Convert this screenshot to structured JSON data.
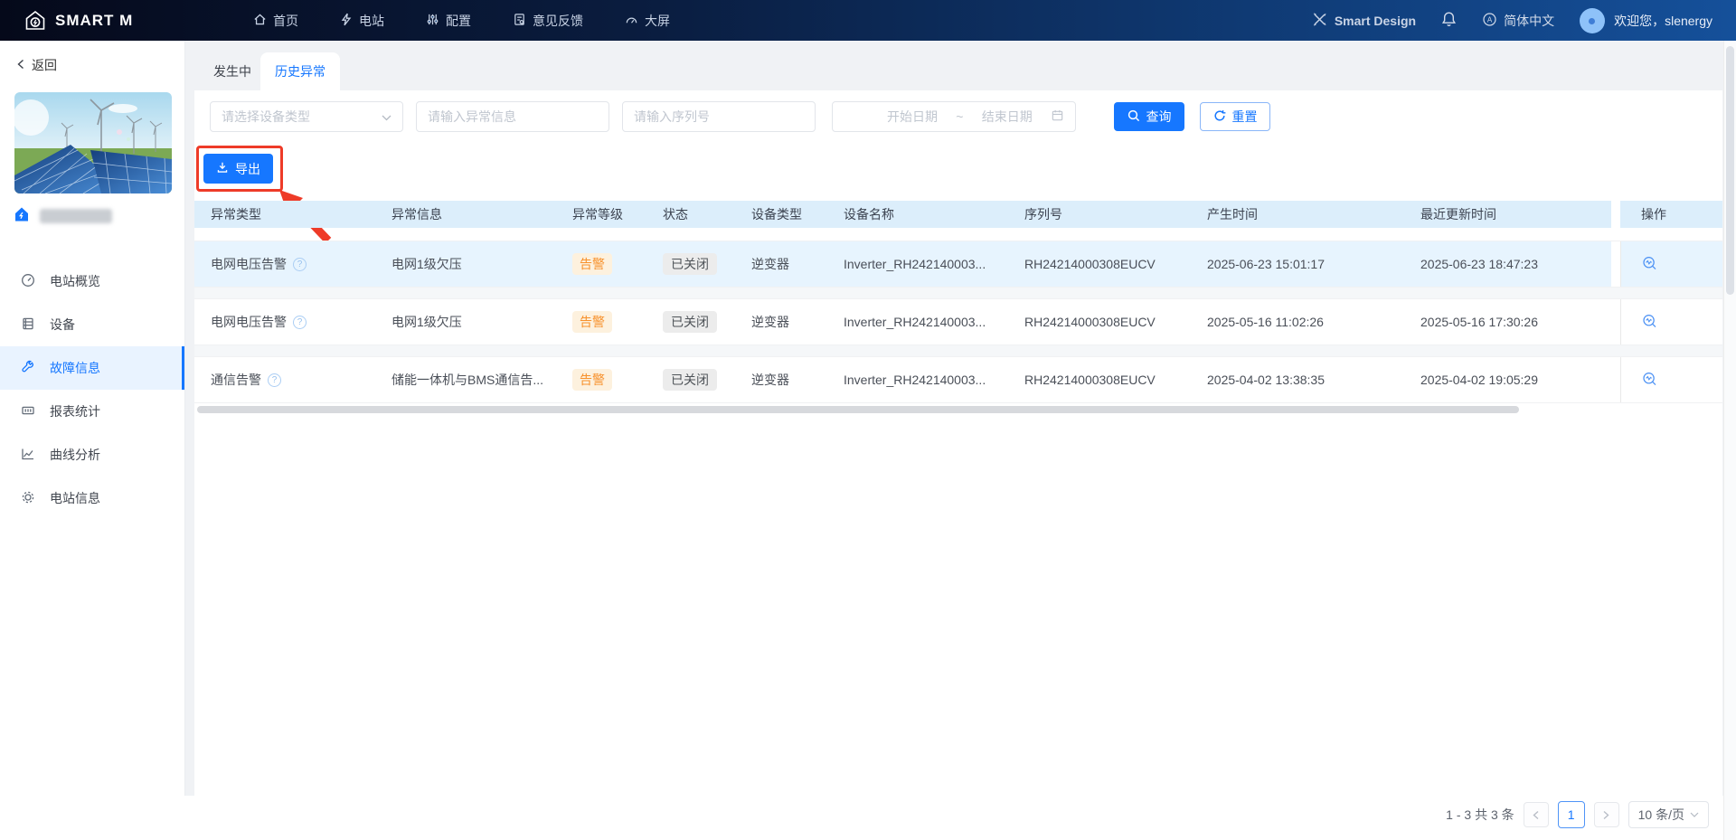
{
  "navbar": {
    "brand": "SMART M",
    "items": [
      {
        "label": "首页"
      },
      {
        "label": "电站"
      },
      {
        "label": "配置"
      },
      {
        "label": "意见反馈"
      },
      {
        "label": "大屏"
      }
    ],
    "smart_design": "Smart Design",
    "language": "简体中文",
    "welcome": "欢迎您，slenergy"
  },
  "sidebar": {
    "back_label": "返回",
    "menu": [
      {
        "label": "电站概览"
      },
      {
        "label": "设备"
      },
      {
        "label": "故障信息"
      },
      {
        "label": "报表统计"
      },
      {
        "label": "曲线分析"
      },
      {
        "label": "电站信息"
      }
    ]
  },
  "tabs": {
    "ongoing": "发生中",
    "history": "历史异常"
  },
  "filters": {
    "device_type_placeholder": "请选择设备类型",
    "info_placeholder": "请输入异常信息",
    "sn_placeholder": "请输入序列号",
    "date_start": "开始日期",
    "date_separator": "~",
    "date_end": "结束日期",
    "query_label": "查询",
    "reset_label": "重置"
  },
  "export_label": "导出",
  "help_glyph": "?",
  "table": {
    "columns": [
      "异常类型",
      "异常信息",
      "异常等级",
      "状态",
      "设备类型",
      "设备名称",
      "序列号",
      "产生时间",
      "最近更新时间",
      "操作"
    ],
    "rows": [
      {
        "type": "电网电压告警",
        "info": "电网1级欠压",
        "level": "告警",
        "status": "已关闭",
        "device_type": "逆变器",
        "device_name": "Inverter_RH242140003...",
        "serial": "RH24214000308EUCV",
        "created": "2025-06-23 15:01:17",
        "updated": "2025-06-23 18:47:23"
      },
      {
        "type": "电网电压告警",
        "info": "电网1级欠压",
        "level": "告警",
        "status": "已关闭",
        "device_type": "逆变器",
        "device_name": "Inverter_RH242140003...",
        "serial": "RH24214000308EUCV",
        "created": "2025-05-16 11:02:26",
        "updated": "2025-05-16 17:30:26"
      },
      {
        "type": "通信告警",
        "info": "储能一体机与BMS通信告...",
        "level": "告警",
        "status": "已关闭",
        "device_type": "逆变器",
        "device_name": "Inverter_RH242140003...",
        "serial": "RH24214000308EUCV",
        "created": "2025-04-02 13:38:35",
        "updated": "2025-04-02 19:05:29"
      }
    ]
  },
  "pagination": {
    "total": "1 - 3 共 3 条",
    "page": "1",
    "page_size": "10 条/页"
  },
  "colors": {
    "accent": "#1677ff",
    "warning": "#fa8c16",
    "annotation": "#ee3b28",
    "header_bg": "#dceefb"
  }
}
